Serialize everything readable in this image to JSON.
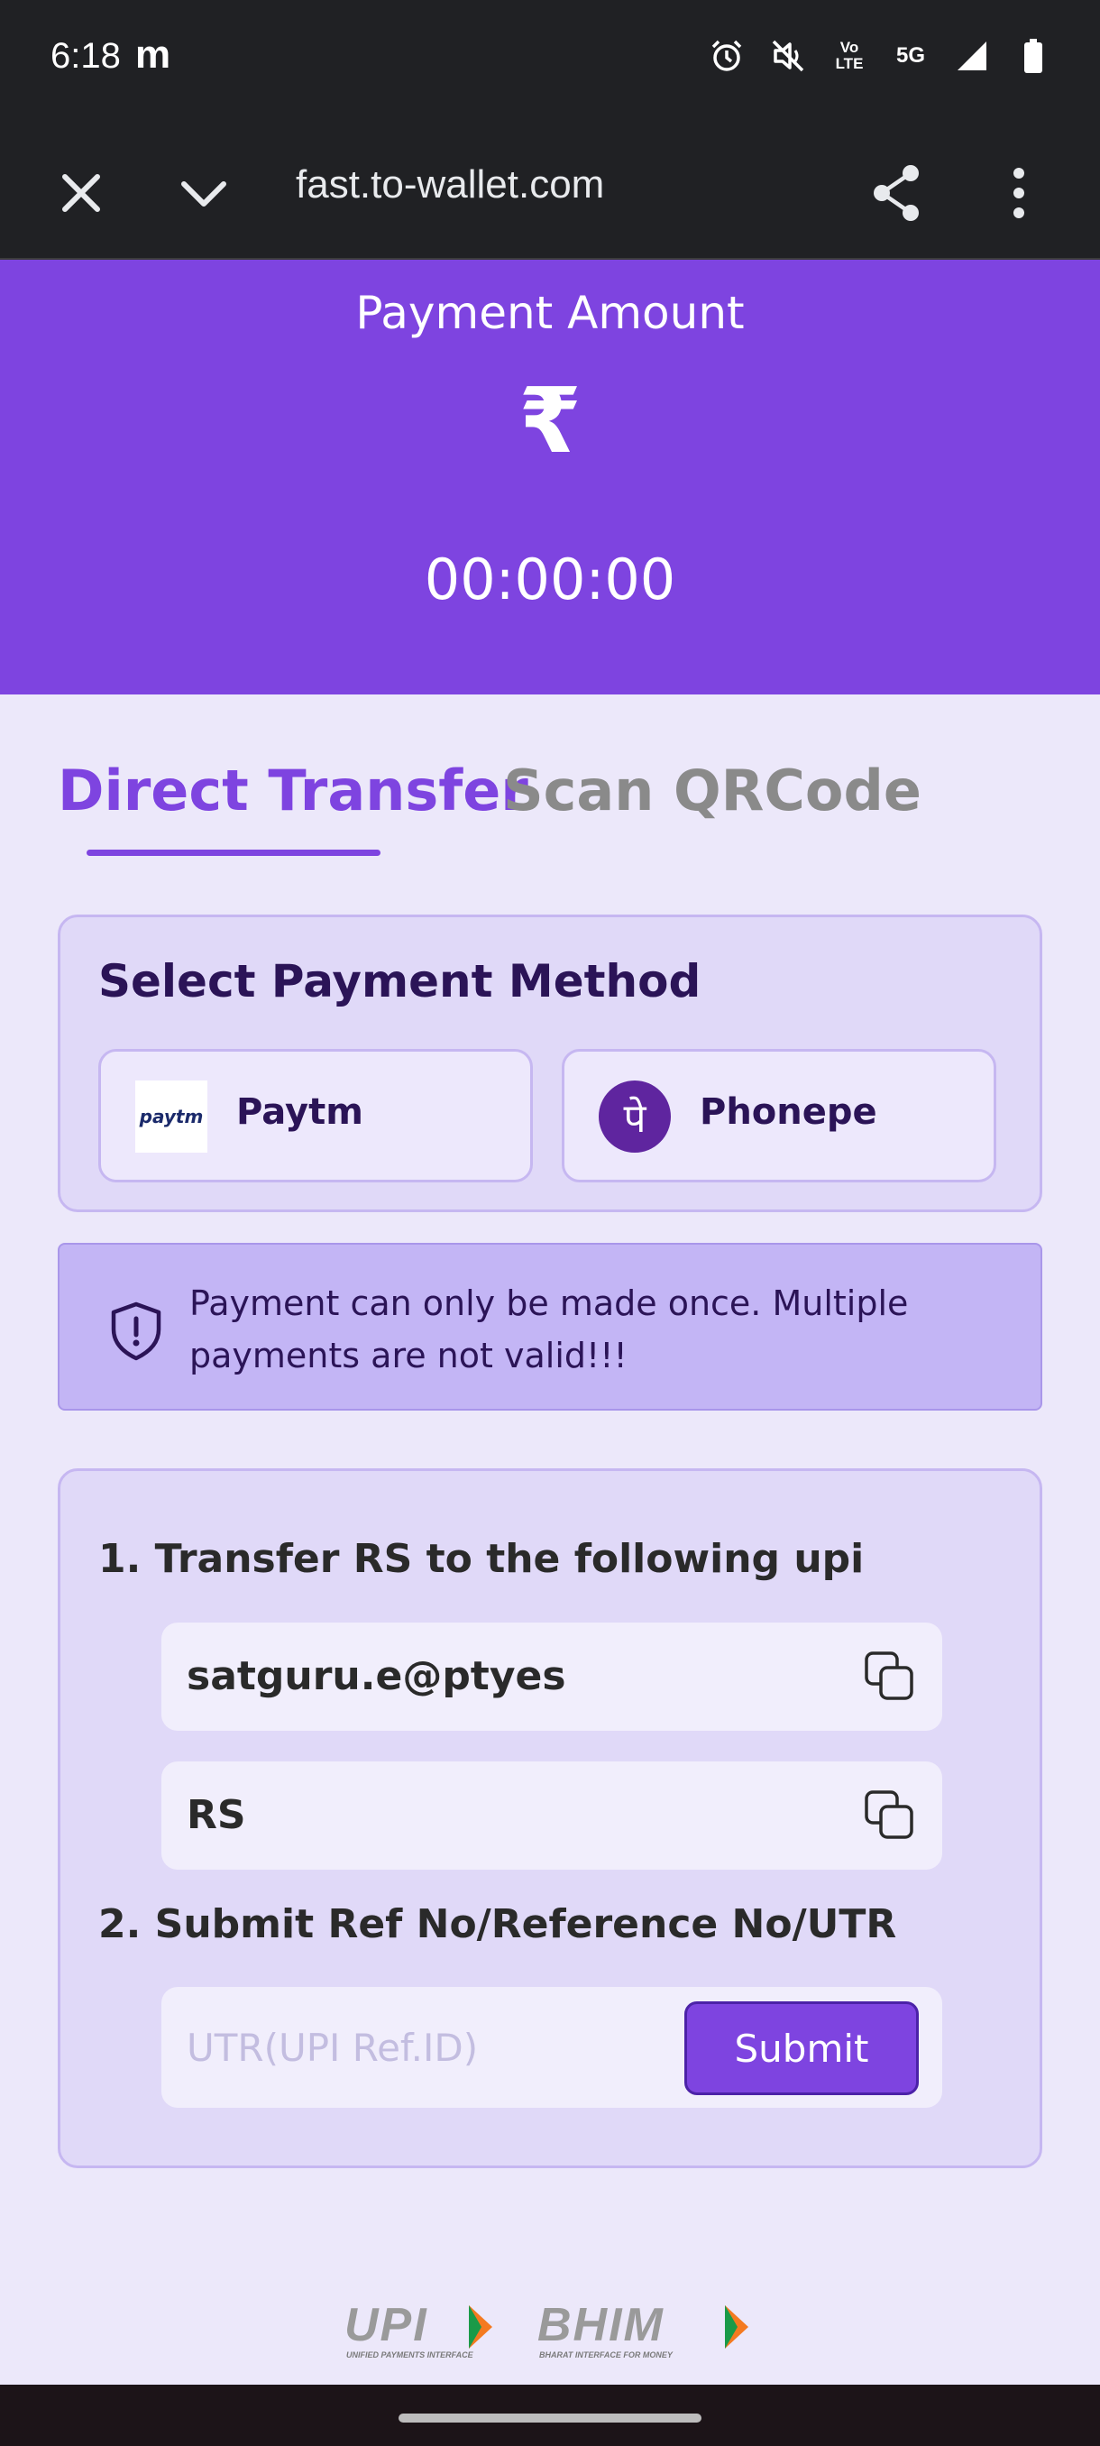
{
  "status_bar": {
    "time": "6:18",
    "notification_glyph": "m",
    "icons": [
      "alarm-icon",
      "vibrate-off-icon",
      "volte-icon",
      "5g-icon",
      "signal-icon",
      "battery-icon"
    ],
    "volte_label": "Vo LTE",
    "network_label": "5G"
  },
  "browser": {
    "url": "fast.to-wallet.com",
    "buttons": [
      "close-icon",
      "chevron-down-icon",
      "share-icon",
      "more-vert-icon"
    ]
  },
  "payment_header": {
    "title": "Payment Amount",
    "currency_symbol": "₹",
    "timer": "00:00:00",
    "background": "#7e44e0"
  },
  "tabs": {
    "direct": "Direct Transfer",
    "scan": "Scan QRCode",
    "active": "direct"
  },
  "payment_method": {
    "title": "Select Payment Method",
    "options": [
      {
        "label": "Paytm",
        "logo_text": "paytm"
      },
      {
        "label": "Phonepe",
        "logo_text": "पे"
      }
    ]
  },
  "warning": {
    "text": "Payment can only be made once. Multiple payments are not valid!!!"
  },
  "transfer": {
    "step1": "1. Transfer RS to the following upi",
    "upi_id": "satguru.e@ptyes",
    "amount_value": "RS",
    "step2": "2. Submit Ref No/Reference No/UTR",
    "utr_placeholder": "UTR(UPI Ref.ID)",
    "submit_label": "Submit"
  },
  "footer": {
    "upi_word": "UPI",
    "upi_sub": "UNIFIED PAYMENTS INTERFACE",
    "bhim_word": "BHIM",
    "bhim_sub": "BHARAT INTERFACE FOR MONEY"
  },
  "colors": {
    "accent": "#7e44e0",
    "page_bg": "#ece8fa",
    "card_bg": "#e0d9f8",
    "warning_bg": "#c3b5f5"
  }
}
